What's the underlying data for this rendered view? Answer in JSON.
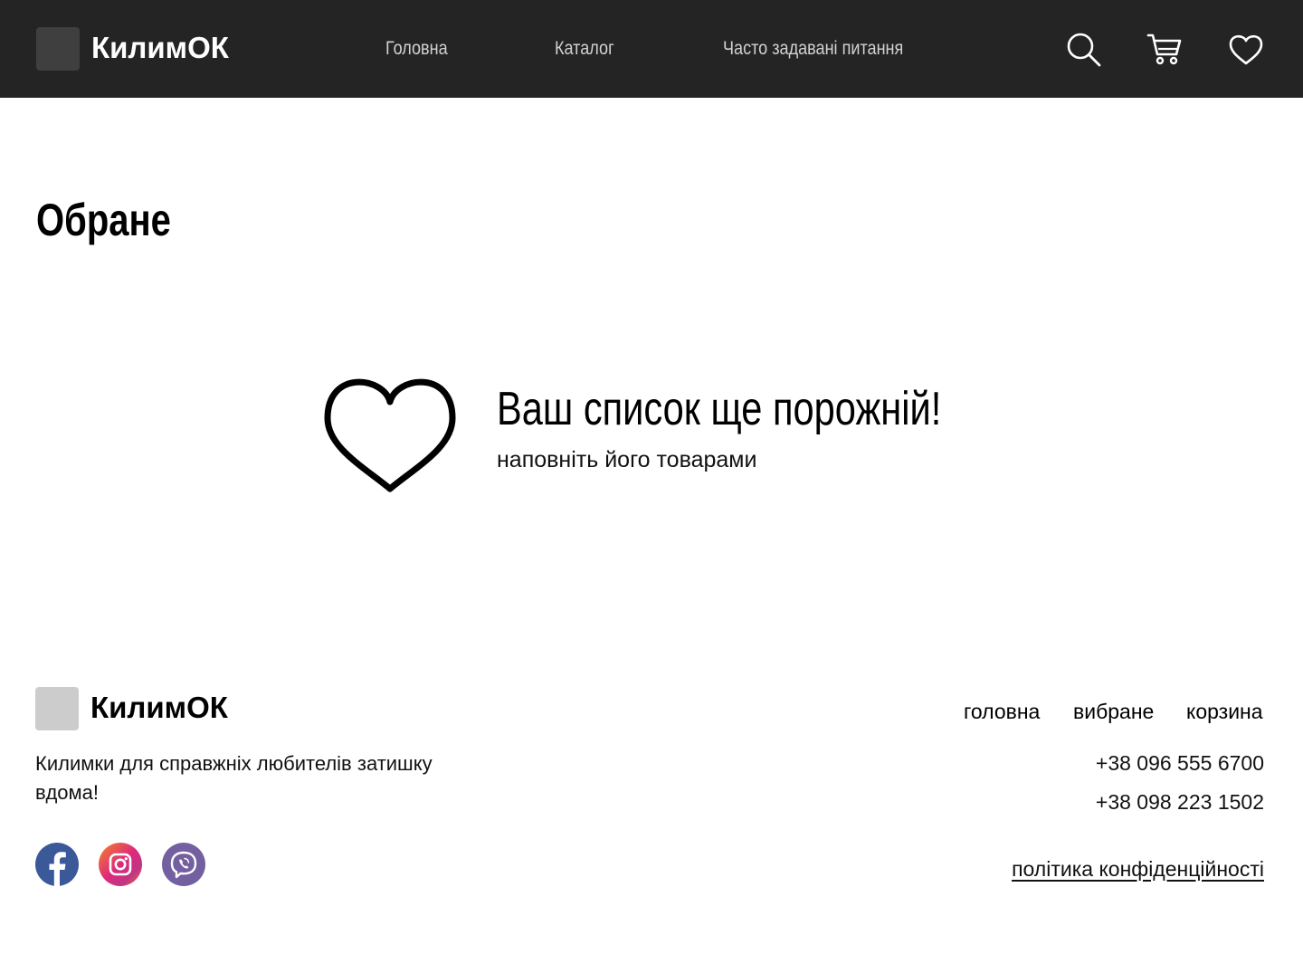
{
  "header": {
    "brand": "КилимОК",
    "nav": {
      "home": "Головна",
      "catalog": "Каталог",
      "faq": "Часто задавані питання"
    },
    "icons": [
      "search-icon",
      "cart-icon",
      "heart-icon"
    ]
  },
  "page": {
    "title": "Обране"
  },
  "empty_state": {
    "icon": "heart-icon",
    "title": "Ваш список ще порожній!",
    "subtitle": "наповніть його товарами"
  },
  "footer": {
    "brand": "КилимОК",
    "tagline": "Килимки для справжніх любителів затишку вдома!",
    "social": [
      {
        "name": "facebook-icon",
        "color": "#3b5998"
      },
      {
        "name": "instagram-icon",
        "color": "#dd2a7b"
      },
      {
        "name": "viber-icon",
        "color": "#7360a0"
      }
    ],
    "nav": {
      "home": "головна",
      "favorites": "вибране",
      "cart": "корзина"
    },
    "phones": [
      "+38 096 555 6700",
      "+38 098 223 1502"
    ],
    "policy": "політика конфіденційності"
  },
  "colors": {
    "header_bg": "#242424",
    "nav_text": "#d2d2d2"
  }
}
